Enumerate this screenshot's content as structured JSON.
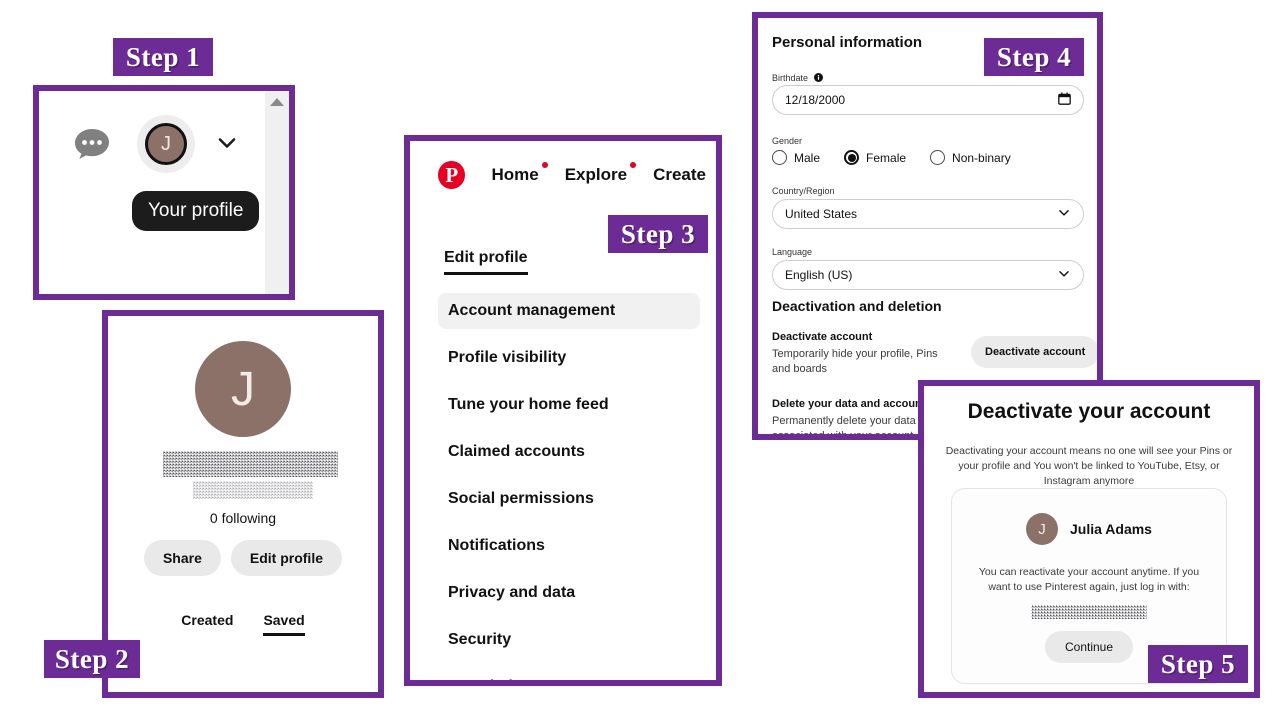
{
  "colors": {
    "accent_purple": "#6d2b96",
    "pinterest_red": "#e60023",
    "avatar_brown": "#8b7168",
    "tooltip_black": "#1c1c1c"
  },
  "steps": {
    "step1_label": "Step 1",
    "step2_label": "Step 2",
    "step3_label": "Step 3",
    "step4_label": "Step 4",
    "step5_label": "Step 5"
  },
  "step1": {
    "chat_icon": "chat-bubble-icon",
    "avatar_initial": "J",
    "chevron_icon": "chevron-down-icon",
    "tooltip": "Your profile",
    "scroll_up_icon": "scroll-up-arrow-icon"
  },
  "step2": {
    "avatar_initial": "J",
    "name_redacted": "",
    "handle_redacted": "",
    "following": "0 following",
    "share_label": "Share",
    "edit_profile_label": "Edit profile",
    "tabs": [
      {
        "label": "Created",
        "active": false
      },
      {
        "label": "Saved",
        "active": true
      }
    ]
  },
  "step3": {
    "logo": "pinterest-logo",
    "nav": [
      {
        "label": "Home",
        "badge": true
      },
      {
        "label": "Explore",
        "badge": true
      },
      {
        "label": "Create",
        "badge": false
      }
    ],
    "section_title": "Edit profile",
    "menu": [
      {
        "label": "Account management",
        "selected": true
      },
      {
        "label": "Profile visibility",
        "selected": false
      },
      {
        "label": "Tune your home feed",
        "selected": false
      },
      {
        "label": "Claimed accounts",
        "selected": false
      },
      {
        "label": "Social permissions",
        "selected": false
      },
      {
        "label": "Notifications",
        "selected": false
      },
      {
        "label": "Privacy and data",
        "selected": false
      },
      {
        "label": "Security",
        "selected": false
      },
      {
        "label": "Branded Content",
        "selected": false
      }
    ]
  },
  "step4": {
    "title": "Personal information",
    "birthdate_label": "Birthdate",
    "birthdate_info_icon": "info-icon",
    "birthdate_value": "12/18/2000",
    "calendar_icon": "calendar-icon",
    "gender_label": "Gender",
    "gender_options": [
      {
        "label": "Male",
        "checked": false
      },
      {
        "label": "Female",
        "checked": true
      },
      {
        "label": "Non-binary",
        "checked": false
      }
    ],
    "country_label": "Country/Region",
    "country_value": "United States",
    "language_label": "Language",
    "language_value": "English (US)",
    "deactivation_heading": "Deactivation and deletion",
    "deactivate_account_head": "Deactivate account",
    "deactivate_account_body": "Temporarily hide your profile, Pins and boards",
    "deactivate_button": "Deactivate account",
    "delete_head": "Delete your data and account",
    "delete_body": "Permanently delete your data and associated with your account",
    "dropdown_icon": "chevron-down-icon"
  },
  "step5": {
    "title": "Deactivate your account",
    "subtitle": "Deactivating your account means no one will see your Pins or your profile and You won't be linked to YouTube, Etsy, or Instagram anymore",
    "user_avatar_initial": "J",
    "user_name": "Julia Adams",
    "reactivate_text": "You can reactivate your account anytime. If you want to use Pinterest again, just log in with:",
    "email_redacted": "",
    "continue_label": "Continue"
  }
}
